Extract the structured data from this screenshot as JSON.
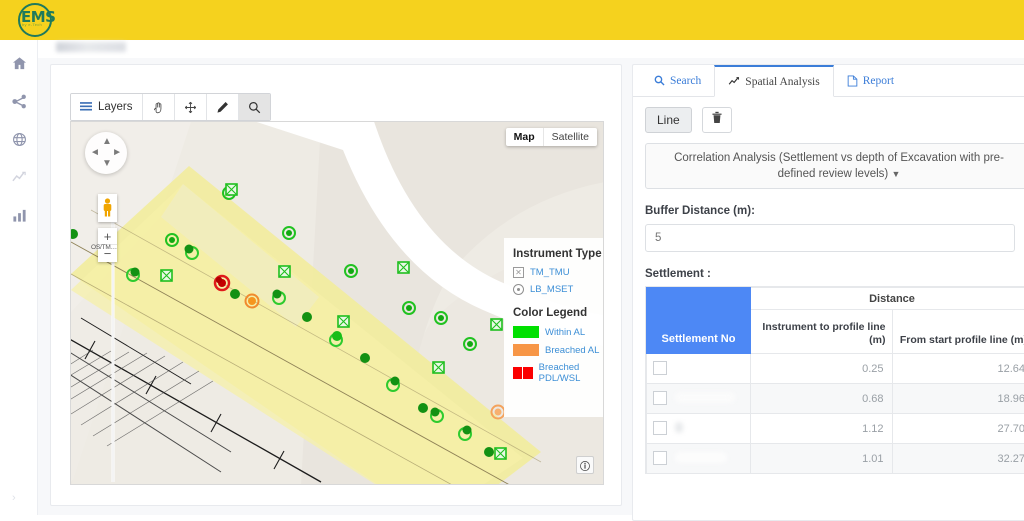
{
  "app": {
    "logo_text": "EMS",
    "logo_sub": "by e-Tech",
    "breadcrumb": ""
  },
  "sidebar": {
    "items": [
      {
        "name": "home",
        "icon": "home-icon"
      },
      {
        "name": "network",
        "icon": "share-nodes-icon"
      },
      {
        "name": "globe",
        "icon": "globe-icon"
      },
      {
        "name": "trend",
        "icon": "line-chart-icon"
      },
      {
        "name": "reports",
        "icon": "bar-chart-icon"
      }
    ],
    "collapse_glyph": "›"
  },
  "map": {
    "toolbar": {
      "layers_label": "Layers",
      "buttons": [
        {
          "id": "layers",
          "label": "Layers",
          "icon": "list-icon",
          "active": false
        },
        {
          "id": "pan",
          "label": "",
          "icon": "hand-icon",
          "active": false
        },
        {
          "id": "move",
          "label": "",
          "icon": "arrows-move-icon",
          "active": false
        },
        {
          "id": "draw",
          "label": "",
          "icon": "pencil-icon",
          "active": false
        },
        {
          "id": "search",
          "label": "",
          "icon": "magnifier-icon",
          "active": true
        }
      ]
    },
    "map_type": {
      "map_label": "Map",
      "satellite_label": "Satellite",
      "selected": "Map"
    },
    "zoom_in": "+",
    "zoom_out": "−",
    "attribution": "OS/TM…",
    "info_glyph": "ℹ",
    "legend": {
      "instrument_title": "Instrument Type",
      "instrument_items": [
        {
          "label": "TM_TMU",
          "symbol": "square-x-icon"
        },
        {
          "label": "LB_MSET",
          "symbol": "circle-dot-icon"
        }
      ],
      "color_title": "Color Legend",
      "color_items": [
        {
          "label": "Within AL",
          "color": "#00e000"
        },
        {
          "label": "Breached AL",
          "color": "#f79646"
        },
        {
          "label": "Breached PDL/WSL",
          "color": "#fb0000"
        }
      ]
    }
  },
  "panel": {
    "tabs": [
      {
        "id": "search",
        "label": "Search",
        "icon": "magnifier-icon",
        "active": false
      },
      {
        "id": "spatial",
        "label": "Spatial Analysis",
        "icon": "line-chart-icon",
        "active": true
      },
      {
        "id": "report",
        "label": "Report",
        "icon": "file-icon",
        "active": false
      }
    ],
    "line_button": "Line",
    "delete_icon": "trash-icon",
    "analysis_select": "Correlation Analysis (Settlement vs depth of Excavation with pre-defined review levels)",
    "buffer_label": "Buffer Distance (m):",
    "buffer_value": "5",
    "settlement_label": "Settlement :"
  },
  "table": {
    "col_settlement_no": "Settlement No",
    "col_distance_group": "Distance",
    "col_instrument_to_profile": "Instrument to profile line (m)",
    "col_from_start_profile": "From start profile line (m)",
    "rows": [
      {
        "settlement_no": "",
        "instrument_to_profile": "0.25",
        "from_start_profile": "12.64"
      },
      {
        "settlement_no": "",
        "instrument_to_profile": "0.68",
        "from_start_profile": "18.96"
      },
      {
        "settlement_no": "",
        "instrument_to_profile": "1.12",
        "from_start_profile": "27.70"
      },
      {
        "settlement_no": "",
        "instrument_to_profile": "1.01",
        "from_start_profile": "32.27"
      }
    ]
  },
  "colors": {
    "brand_yellow": "#f5d21e",
    "header_blue": "#4d88f5",
    "link_blue": "#3b7dd8",
    "logo_green": "#1f7a5c"
  },
  "markers": {
    "green_circles": [
      [
        100,
        117
      ],
      [
        157,
        72
      ],
      [
        217,
        112
      ],
      [
        279,
        148
      ],
      [
        338,
        184
      ],
      [
        370,
        195
      ],
      [
        399,
        221
      ],
      [
        423,
        239
      ],
      [
        60,
        95
      ],
      [
        121,
        131
      ],
      [
        178,
        166
      ],
      [
        208,
        174
      ],
      [
        235,
        191
      ],
      [
        265,
        216
      ],
      [
        294,
        236
      ],
      [
        322,
        262
      ],
      [
        352,
        285
      ],
      [
        379,
        302
      ],
      [
        408,
        320
      ]
    ],
    "square_markers": [
      [
        160,
        68
      ],
      [
        95,
        153
      ],
      [
        213,
        149
      ],
      [
        330,
        145
      ],
      [
        271,
        199
      ],
      [
        424,
        202
      ],
      [
        366,
        244
      ],
      [
        429,
        330
      ]
    ],
    "red_markers": [
      [
        150,
        162
      ]
    ],
    "orange_markers": [
      [
        180,
        178
      ],
      [
        427,
        290
      ]
    ]
  }
}
